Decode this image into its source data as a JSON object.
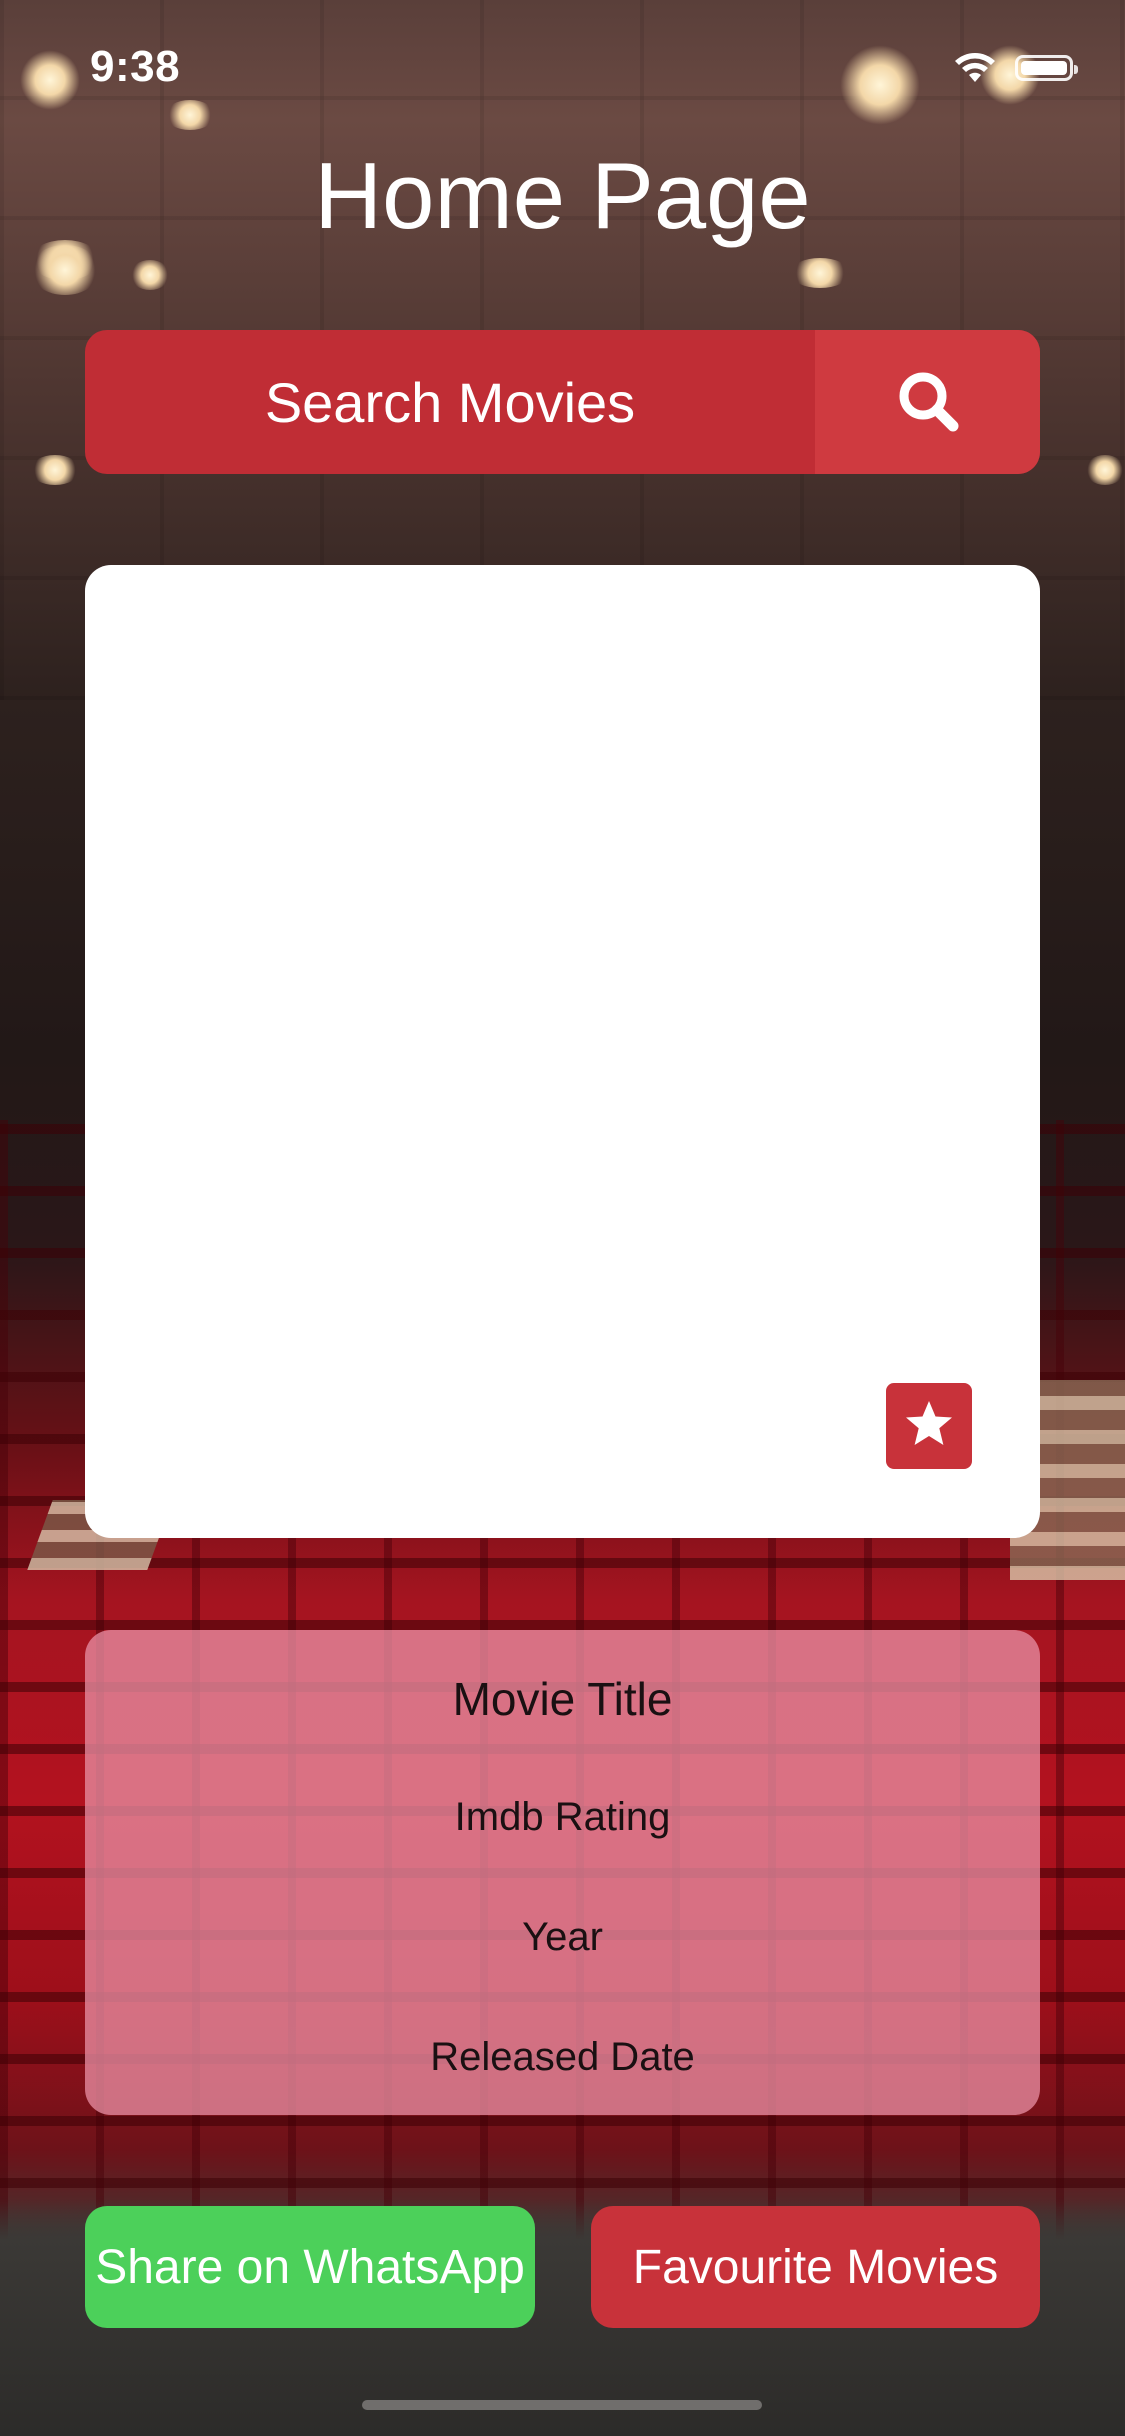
{
  "status_bar": {
    "time": "9:38"
  },
  "header": {
    "title": "Home Page"
  },
  "search": {
    "placeholder": "Search Movies",
    "button_icon": "search-icon"
  },
  "poster_card": {
    "favourite_icon": "star-icon"
  },
  "details": {
    "title": "Movie Title",
    "rating": "Imdb Rating",
    "year": "Year",
    "released": "Released Date"
  },
  "actions": {
    "share_label": "Share on WhatsApp",
    "favourites_label": "Favourite Movies"
  },
  "colors": {
    "primary_red": "#c8323a",
    "search_button_red": "#cf3a40",
    "whatsapp_green": "#4cd05a",
    "details_panel": "#e68ca0",
    "poster_bg": "#ffffff"
  }
}
